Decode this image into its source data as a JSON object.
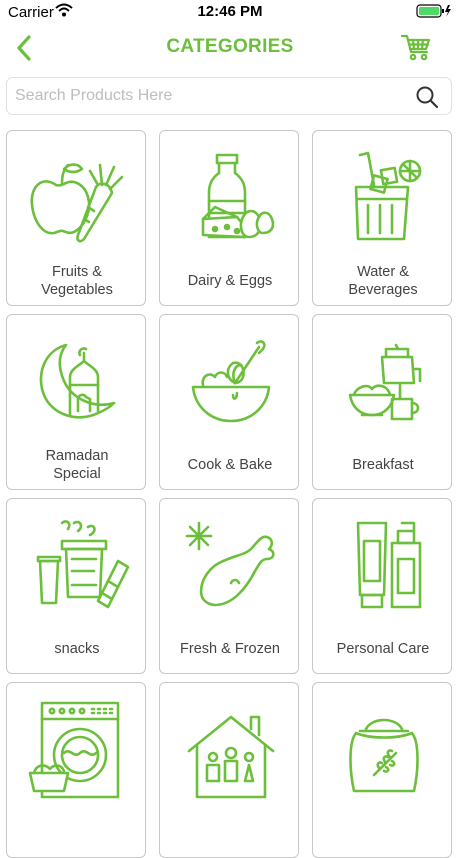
{
  "status_bar": {
    "carrier": "Carrier",
    "time": "12:46 PM"
  },
  "header": {
    "title": "CATEGORIES"
  },
  "search": {
    "placeholder": "Search Products Here",
    "value": ""
  },
  "categories": [
    {
      "label": "Fruits &\nVegetables",
      "icon": "fruit-vegetable-icon"
    },
    {
      "label": "Dairy & Eggs",
      "icon": "dairy-eggs-icon"
    },
    {
      "label": "Water &\nBeverages",
      "icon": "beverage-icon"
    },
    {
      "label": "Ramadan\nSpecial",
      "icon": "crescent-mosque-icon"
    },
    {
      "label": "Cook & Bake",
      "icon": "mixing-bowl-icon"
    },
    {
      "label": "Breakfast",
      "icon": "breakfast-icon"
    },
    {
      "label": "snacks",
      "icon": "snacks-icon"
    },
    {
      "label": "Fresh & Frozen",
      "icon": "frozen-chicken-icon"
    },
    {
      "label": "Personal Care",
      "icon": "personal-care-icon"
    },
    {
      "label": "",
      "icon": "washing-machine-icon"
    },
    {
      "label": "",
      "icon": "household-icon"
    },
    {
      "label": "",
      "icon": "grain-sack-icon"
    }
  ],
  "colors": {
    "accent": "#6cbf3b",
    "border": "#c8c8c8",
    "text": "#444444"
  }
}
